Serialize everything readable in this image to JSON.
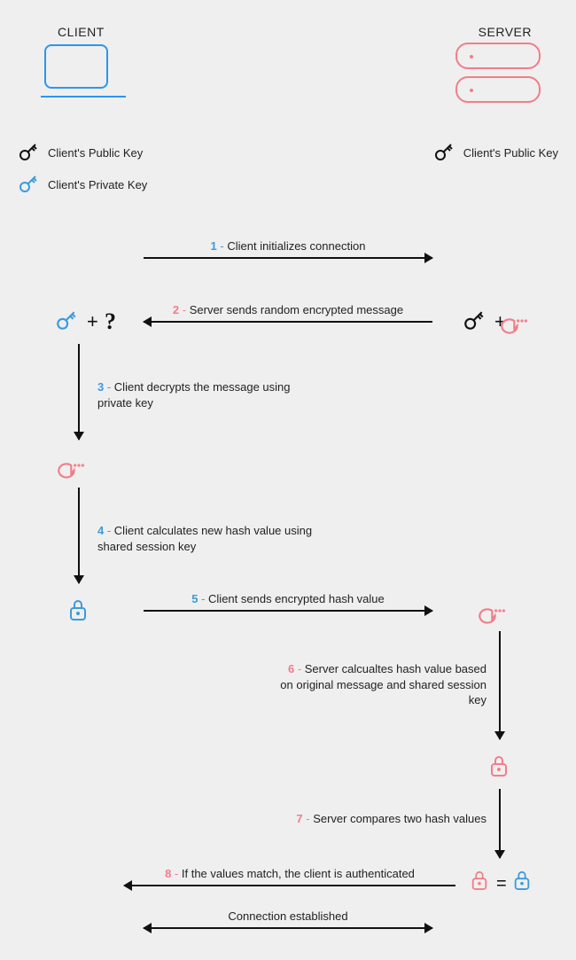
{
  "headers": {
    "client": "CLIENT",
    "server": "SERVER"
  },
  "legend": {
    "client_public": "Client's Public Key",
    "client_private": "Client's Private Key",
    "server_public": "Client's Public Key"
  },
  "steps": {
    "s1": {
      "num": "1",
      "text": "Client initializes connection"
    },
    "s2": {
      "num": "2",
      "text": "Server sends random encrypted message"
    },
    "s3": {
      "num": "3",
      "text": "Client decrypts the message using private key"
    },
    "s4": {
      "num": "4",
      "text": "Client calculates new hash value using shared session key"
    },
    "s5": {
      "num": "5",
      "text": "Client sends encrypted hash value"
    },
    "s6": {
      "num": "6",
      "text": "Server calcualtes hash value based on original message and shared session key"
    },
    "s7": {
      "num": "7",
      "text": "Server compares two hash values"
    },
    "s8": {
      "num": "8",
      "text": "If the values match, the client is authenticated"
    },
    "final": "Connection established"
  },
  "symbols": {
    "plus": "+",
    "question": "?",
    "equals": "="
  },
  "colors": {
    "blue": "#3B9BDC",
    "salmon": "#F17E8A"
  }
}
